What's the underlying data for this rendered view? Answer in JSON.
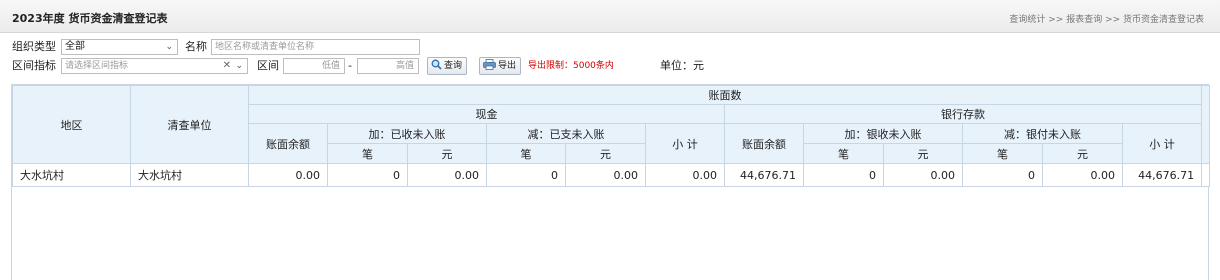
{
  "title": "2023年度 货币资金清查登记表",
  "breadcrumb": "查询统计 >> 报表查询 >> 货币资金清查登记表",
  "filters": {
    "org_type_label": "组织类型",
    "org_type_value": "全部",
    "name_label": "名称",
    "name_placeholder": "地区名称或清查单位名称",
    "range_metric_label": "区间指标",
    "range_metric_placeholder": "请选择区间指标",
    "range_label": "区间",
    "low_placeholder": "低值",
    "dash": "-",
    "high_placeholder": "高值",
    "query_button": "查询",
    "export_button": "导出",
    "export_limit": "导出限制：5000条内",
    "unit": "单位：元"
  },
  "table": {
    "col_region": "地区",
    "col_unit": "清查单位",
    "col_book": "账面数",
    "group_cash": "现金",
    "group_bank": "银行存款",
    "book_balance": "账面余额",
    "add_received": "加：已收未入账",
    "sub_paid": "减：已支未入账",
    "add_bank_received": "加：银收未入账",
    "sub_bank_paid": "减：银付未入账",
    "subtotal": "小 计",
    "count": "笔",
    "yuan": "元",
    "rows": [
      {
        "region": "大水坑村",
        "unit": "大水坑村",
        "cash_balance": "0.00",
        "cash_add_count": "0",
        "cash_add_amount": "0.00",
        "cash_sub_count": "0",
        "cash_sub_amount": "0.00",
        "cash_subtotal": "0.00",
        "bank_balance": "44,676.71",
        "bank_add_count": "0",
        "bank_add_amount": "0.00",
        "bank_sub_count": "0",
        "bank_sub_amount": "0.00",
        "bank_subtotal": "44,676.71"
      }
    ]
  }
}
